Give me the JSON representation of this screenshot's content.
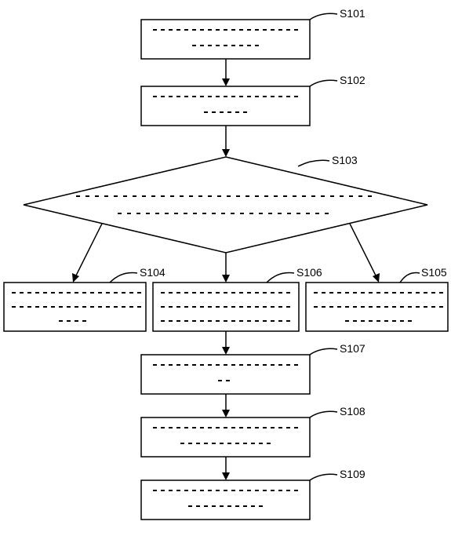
{
  "labels": {
    "s101": "S101",
    "s102": "S102",
    "s103": "S103",
    "s104": "S104",
    "s105": "S105",
    "s106": "S106",
    "s107": "S107",
    "s108": "S108",
    "s109": "S109"
  },
  "chart_data": {
    "type": "flowchart",
    "title": "",
    "nodes": [
      {
        "id": "S101",
        "type": "process",
        "row": 1,
        "column": "center",
        "content_placeholder": true
      },
      {
        "id": "S102",
        "type": "process",
        "row": 2,
        "column": "center",
        "content_placeholder": true
      },
      {
        "id": "S103",
        "type": "decision",
        "row": 3,
        "column": "center",
        "content_placeholder": true
      },
      {
        "id": "S104",
        "type": "process",
        "row": 4,
        "column": "left",
        "content_placeholder": true
      },
      {
        "id": "S106",
        "type": "process",
        "row": 4,
        "column": "center",
        "content_placeholder": true
      },
      {
        "id": "S105",
        "type": "process",
        "row": 4,
        "column": "right",
        "content_placeholder": true
      },
      {
        "id": "S107",
        "type": "process",
        "row": 5,
        "column": "center",
        "content_placeholder": true
      },
      {
        "id": "S108",
        "type": "process",
        "row": 6,
        "column": "center",
        "content_placeholder": true
      },
      {
        "id": "S109",
        "type": "process",
        "row": 7,
        "column": "center",
        "content_placeholder": true
      }
    ],
    "edges": [
      {
        "from": "S101",
        "to": "S102"
      },
      {
        "from": "S102",
        "to": "S103"
      },
      {
        "from": "S103",
        "to": "S104"
      },
      {
        "from": "S103",
        "to": "S106"
      },
      {
        "from": "S103",
        "to": "S105"
      },
      {
        "from": "S106",
        "to": "S107"
      },
      {
        "from": "S107",
        "to": "S108"
      },
      {
        "from": "S108",
        "to": "S109"
      }
    ]
  }
}
